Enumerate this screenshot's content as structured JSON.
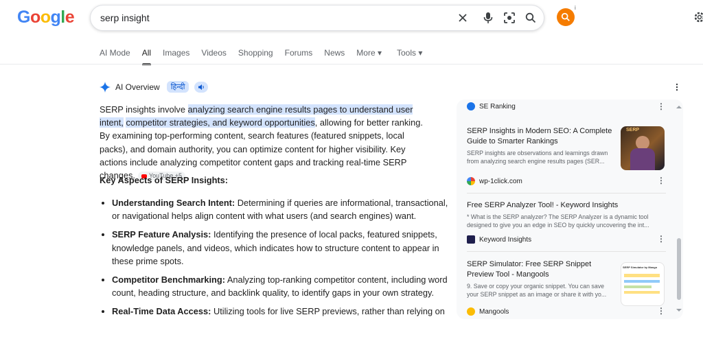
{
  "logo": {
    "letters": [
      "G",
      "o",
      "o",
      "g",
      "l",
      "e"
    ],
    "colors": [
      "#4285f4",
      "#ea4335",
      "#fbbc05",
      "#4285f4",
      "#34a853",
      "#ea4335"
    ]
  },
  "search": {
    "value": "serp insight"
  },
  "tabs": [
    {
      "label": "AI Mode"
    },
    {
      "label": "All",
      "active": true
    },
    {
      "label": "Images"
    },
    {
      "label": "Videos"
    },
    {
      "label": "Shopping"
    },
    {
      "label": "Forums"
    },
    {
      "label": "News"
    },
    {
      "label": "More ▾"
    },
    {
      "label": "Tools ▾"
    }
  ],
  "ai_overview": {
    "title": "AI Overview",
    "lang": "हिन्दी",
    "para": {
      "p1": "SERP insights involve ",
      "hl1": "analyzing search engine results pages to understand user intent,",
      "p2": " ",
      "hl2": "competitor strategies, and keyword opportunities",
      "p3": ", allowing for better ranking. By examining top-performing content, search features (featured snippets, local packs), and domain authority, you can optimize content for higher visibility. Key actions include analyzing competitor content gaps and tracking real-time SERP changes.",
      "chip": "YouTube +5"
    },
    "key_heading": "Key Aspects of SERP Insights:",
    "aspects": [
      {
        "term": "Understanding Search Intent:",
        "text": " Determining if queries are informational, transactional, or navigational helps align content with what users (and search engines) want."
      },
      {
        "term": "SERP Feature Analysis:",
        "text": " Identifying the presence of local packs, featured snippets, knowledge panels, and videos, which indicates how to structure content to appear in these prime spots."
      },
      {
        "term": "Competitor Benchmarking:",
        "text": " Analyzing top-ranking competitor content, including word count, heading structure, and backlink quality, to identify gaps in your own strategy."
      },
      {
        "term": "Real-Time Data Access:",
        "text": " Utilizing tools for live SERP previews, rather than relying on"
      }
    ]
  },
  "sources": {
    "top_source": "SE Ranking",
    "cards": [
      {
        "title": "SERP Insights in Modern SEO: A Complete Guide to Smarter Rankings",
        "snippet": "SERP insights are observations and learnings drawn from analyzing search engine results pages (SER...",
        "source": "wp-1click.com",
        "thumb_text": "SERP"
      },
      {
        "title": "Free SERP Analyzer Tool! - Keyword Insights",
        "snippet": "* What is the SERP analyzer? The SERP Analyzer is a dynamic tool designed to give you an edge in SEO by quickly uncovering the int...",
        "source": "Keyword Insights"
      },
      {
        "title": "SERP Simulator: Free SERP Snippet Preview Tool - Mangools",
        "snippet": "9. Save or copy your organic snippet. You can save your SERP snippet as an image or share it with yo...",
        "source": "Mangools",
        "thumb_text": "SERP Simulator by Mango"
      }
    ]
  },
  "colors": {
    "accent": "#0b57d0",
    "highlight": "#d3e3fd",
    "avatar": "#f57c00"
  }
}
